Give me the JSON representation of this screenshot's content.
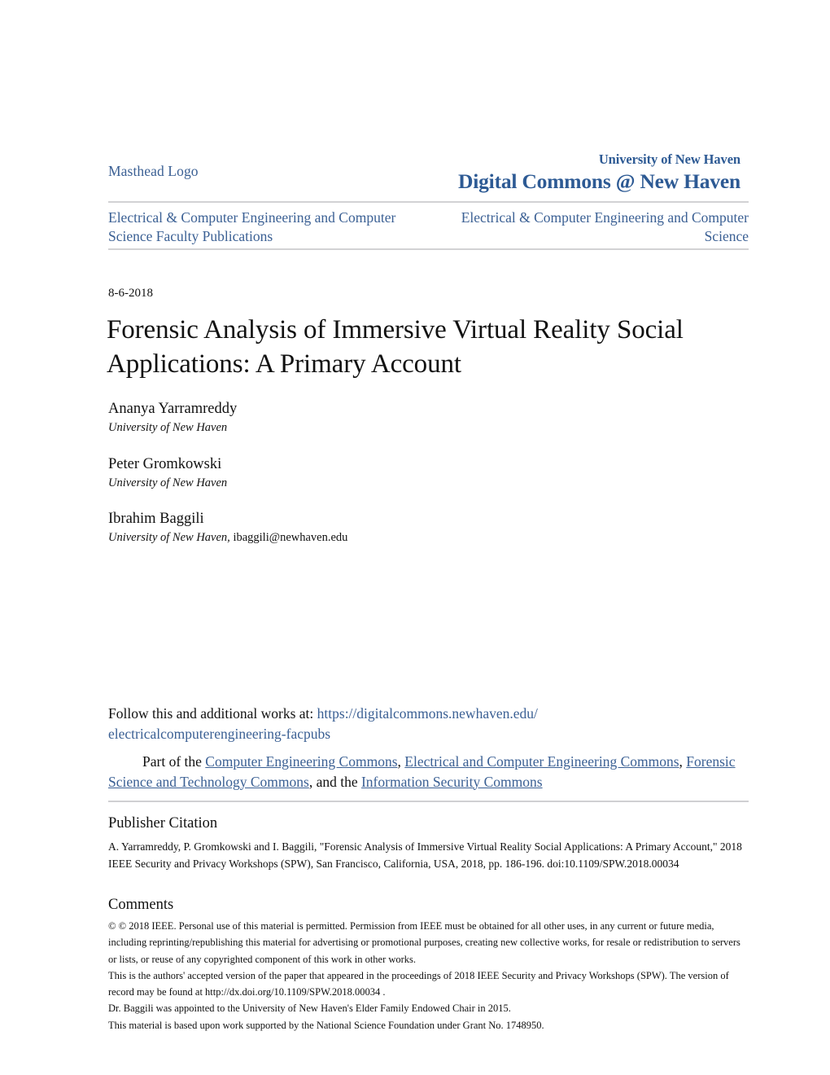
{
  "masthead": {
    "logo_alt_text": "Masthead Logo",
    "university": "University of New Haven",
    "repository": "Digital Commons @ New Haven",
    "brand_color": "#2d5a94",
    "link_color": "#3b6094"
  },
  "breadcrumb": {
    "left": "Electrical & Computer Engineering and Computer Science Faculty Publications",
    "right": "Electrical & Computer Engineering and Computer Science"
  },
  "document": {
    "date": "8-6-2018",
    "title": "Forensic Analysis of Immersive Virtual Reality Social Applications: A Primary Account"
  },
  "authors": [
    {
      "name": "Ananya Yarramreddy",
      "affiliation": "University of New Haven",
      "email": ""
    },
    {
      "name": "Peter Gromkowski",
      "affiliation": "University of New Haven",
      "email": ""
    },
    {
      "name": "Ibrahim Baggili",
      "affiliation": "University of New Haven, ",
      "email": "ibaggili@newhaven.edu"
    }
  ],
  "follow": {
    "lead_text": "Follow this and additional works at: ",
    "url_line1": "https://digitalcommons.newhaven.edu/",
    "url_line2": "electricalcomputerengineering-facpubs",
    "part_of_prefix": "Part of the ",
    "commons_links": [
      "Computer Engineering Commons",
      "Electrical and Computer Engineering Commons",
      "Forensic Science and Technology Commons",
      "Information Security Commons"
    ],
    "separator_comma": ", ",
    "and_the": ", and the "
  },
  "publisher_citation": {
    "heading": "Publisher Citation",
    "body": "A. Yarramreddy, P. Gromkowski and I. Baggili, \"Forensic Analysis of Immersive Virtual Reality Social Applications: A Primary Account,\" 2018 IEEE Security and Privacy Workshops (SPW), San Francisco, California, USA, 2018, pp. 186-196. doi:10.1109/SPW.2018.00034"
  },
  "comments": {
    "heading": "Comments",
    "paragraphs": [
      "© © 2018 IEEE. Personal use of this material is permitted. Permission from IEEE must be obtained for all other uses, in any current or future media, including reprinting/republishing this material for advertising or promotional purposes, creating new collective works, for resale or redistribution to servers or lists, or reuse of any copyrighted component of this work in other works.",
      "This is the authors' accepted version of the paper that appeared in the proceedings of 2018 IEEE Security and Privacy Workshops (SPW). The version of record may be found at http://dx.doi.org/10.1109/SPW.2018.00034 .",
      "Dr. Baggili was appointed to the University of New Haven's Elder Family Endowed Chair in 2015.",
      "This material is based upon work supported by the National Science Foundation under Grant No. 1748950."
    ]
  }
}
